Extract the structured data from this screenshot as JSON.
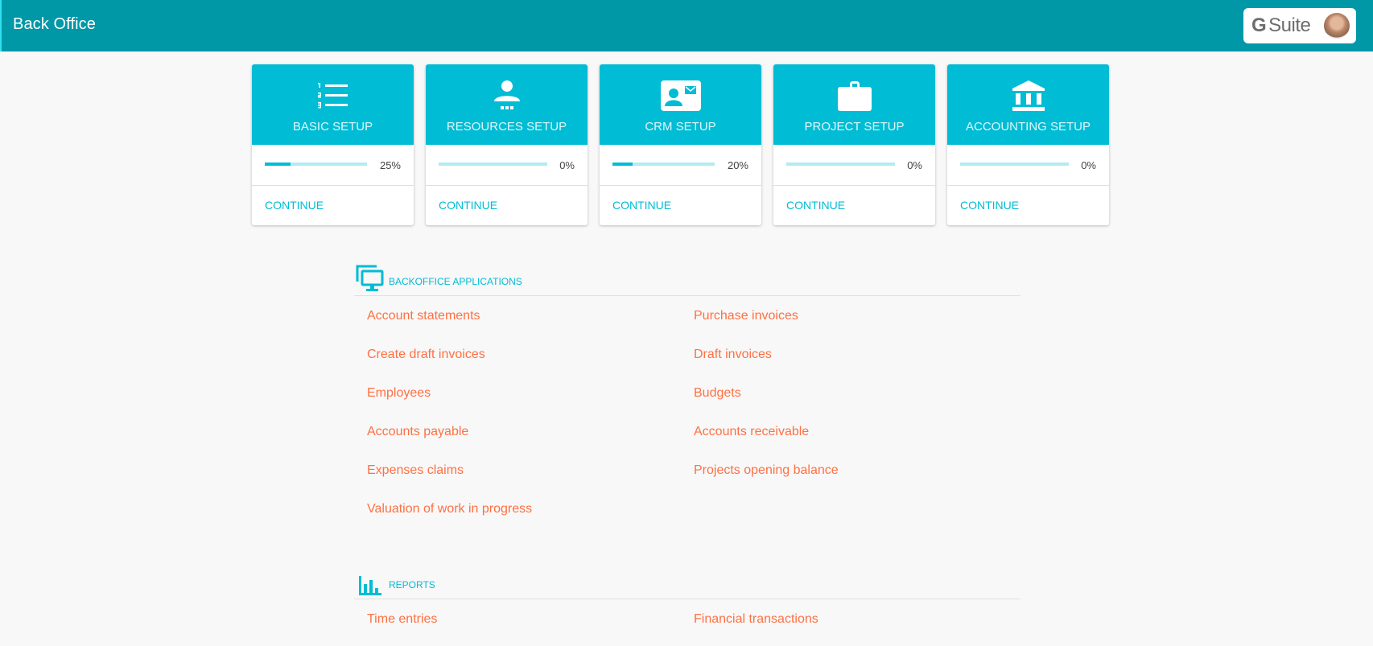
{
  "header": {
    "title": "Back Office",
    "gsuite_label": "G Suite",
    "gsuite_g": "G",
    "gsuite_suite": "Suite",
    "avatar_alt": "user avatar"
  },
  "colors": {
    "header_bg": "#0097a7",
    "card_accent": "#00bcd4",
    "link": "#ff7043"
  },
  "setup_cards": [
    {
      "title": "BASIC SETUP",
      "icon": "numbered-list-icon",
      "progress": 25,
      "progress_label": "25%",
      "action": "CONTINUE"
    },
    {
      "title": "RESOURCES SETUP",
      "icon": "person-resources-icon",
      "progress": 0,
      "progress_label": "0%",
      "action": "CONTINUE"
    },
    {
      "title": "CRM SETUP",
      "icon": "contact-card-icon",
      "progress": 20,
      "progress_label": "20%",
      "action": "CONTINUE"
    },
    {
      "title": "PROJECT SETUP",
      "icon": "briefcase-icon",
      "progress": 0,
      "progress_label": "0%",
      "action": "CONTINUE"
    },
    {
      "title": "ACCOUNTING SETUP",
      "icon": "bank-icon",
      "progress": 0,
      "progress_label": "0%",
      "action": "CONTINUE"
    }
  ],
  "applications": {
    "title": "BACKOFFICE APPLICATIONS",
    "icon": "monitors-icon",
    "links": [
      "Account statements",
      "Purchase invoices",
      "Create draft invoices",
      "Draft invoices",
      "Employees",
      "Budgets",
      "Accounts payable",
      "Accounts receivable",
      "Expenses claims",
      "Projects opening balance",
      "Valuation of work in progress"
    ]
  },
  "reports": {
    "title": "REPORTS",
    "icon": "bar-chart-icon",
    "links": [
      "Time entries",
      "Financial transactions"
    ]
  }
}
